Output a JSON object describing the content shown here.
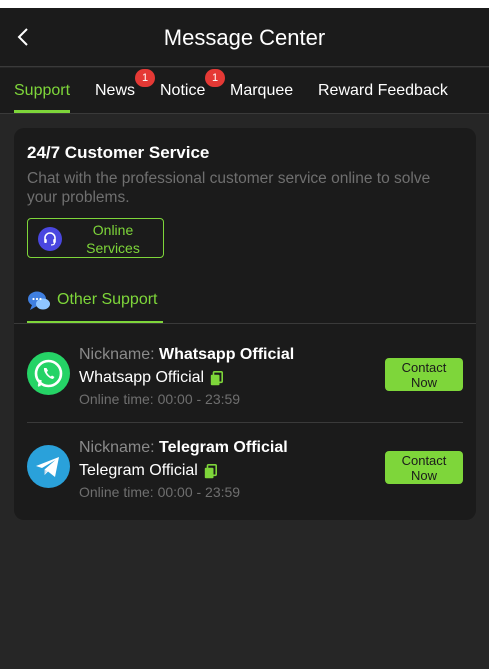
{
  "header": {
    "title": "Message Center",
    "back_icon": "chevron-left-icon"
  },
  "tabs": [
    {
      "label": "Support",
      "active": true
    },
    {
      "label": "News",
      "badge": "1"
    },
    {
      "label": "Notice",
      "badge": "1"
    },
    {
      "label": "Marquee"
    },
    {
      "label": "Reward Feedback"
    }
  ],
  "customer_service": {
    "title": "24/7 Customer Service",
    "description": "Chat with the professional customer service online to solve your problems.",
    "online_button": {
      "label_line1": "Online",
      "label_line2": "Services",
      "icon": "headset-icon"
    }
  },
  "other_support": {
    "label": "Other Support",
    "icon": "chat-bubbles-icon"
  },
  "contacts": [
    {
      "nickname_label": "Nickname:",
      "nickname": "Whatsapp Official",
      "account": "Whatsapp Official",
      "online_time": "Online time: 00:00 - 23:59",
      "button_line1": "Contact",
      "button_line2": "Now",
      "icon": "whatsapp-icon"
    },
    {
      "nickname_label": "Nickname:",
      "nickname": "Telegram Official",
      "account": "Telegram Official",
      "online_time": "Online time: 00:00 - 23:59",
      "button_line1": "Contact",
      "button_line2": "Now",
      "icon": "telegram-icon"
    }
  ],
  "colors": {
    "accent": "#7ed63a",
    "background": "#262626",
    "panel": "#1b1b1b",
    "badge": "#e53935",
    "whatsapp": "#25d366",
    "telegram": "#2aa1da"
  }
}
